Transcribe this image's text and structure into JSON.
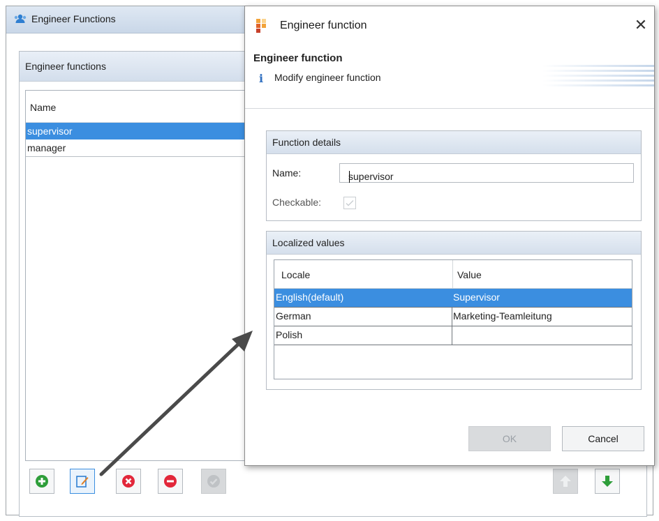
{
  "background_window": {
    "title": "Engineer Functions",
    "group_title": "Engineer functions",
    "list_header": "Name",
    "items": [
      "supervisor",
      "manager"
    ],
    "selected_index": 0,
    "toolbar": [
      "add-icon",
      "edit-icon",
      "delete-icon",
      "remove-icon",
      "check-icon",
      "move-up-icon",
      "move-down-icon"
    ]
  },
  "dialog": {
    "title": "Engineer function",
    "header_title": "Engineer function",
    "header_subtitle": "Modify engineer function",
    "details": {
      "group_title": "Function details",
      "name_label": "Name:",
      "name_value": "supervisor",
      "checkable_label": "Checkable:",
      "checkable_checked": true
    },
    "localized": {
      "group_title": "Localized values",
      "col_locale": "Locale",
      "col_value": "Value",
      "rows": [
        {
          "locale": "English(default)",
          "value": "Supervisor"
        },
        {
          "locale": "German",
          "value": "Marketing-Teamleitung"
        },
        {
          "locale": "Polish",
          "value": ""
        }
      ],
      "selected_index": 0
    },
    "ok_label": "OK",
    "cancel_label": "Cancel",
    "close_glyph": "✕"
  },
  "colors": {
    "selection": "#3b8ee0",
    "accent_green": "#2e9e3a",
    "accent_red": "#e2273a"
  }
}
